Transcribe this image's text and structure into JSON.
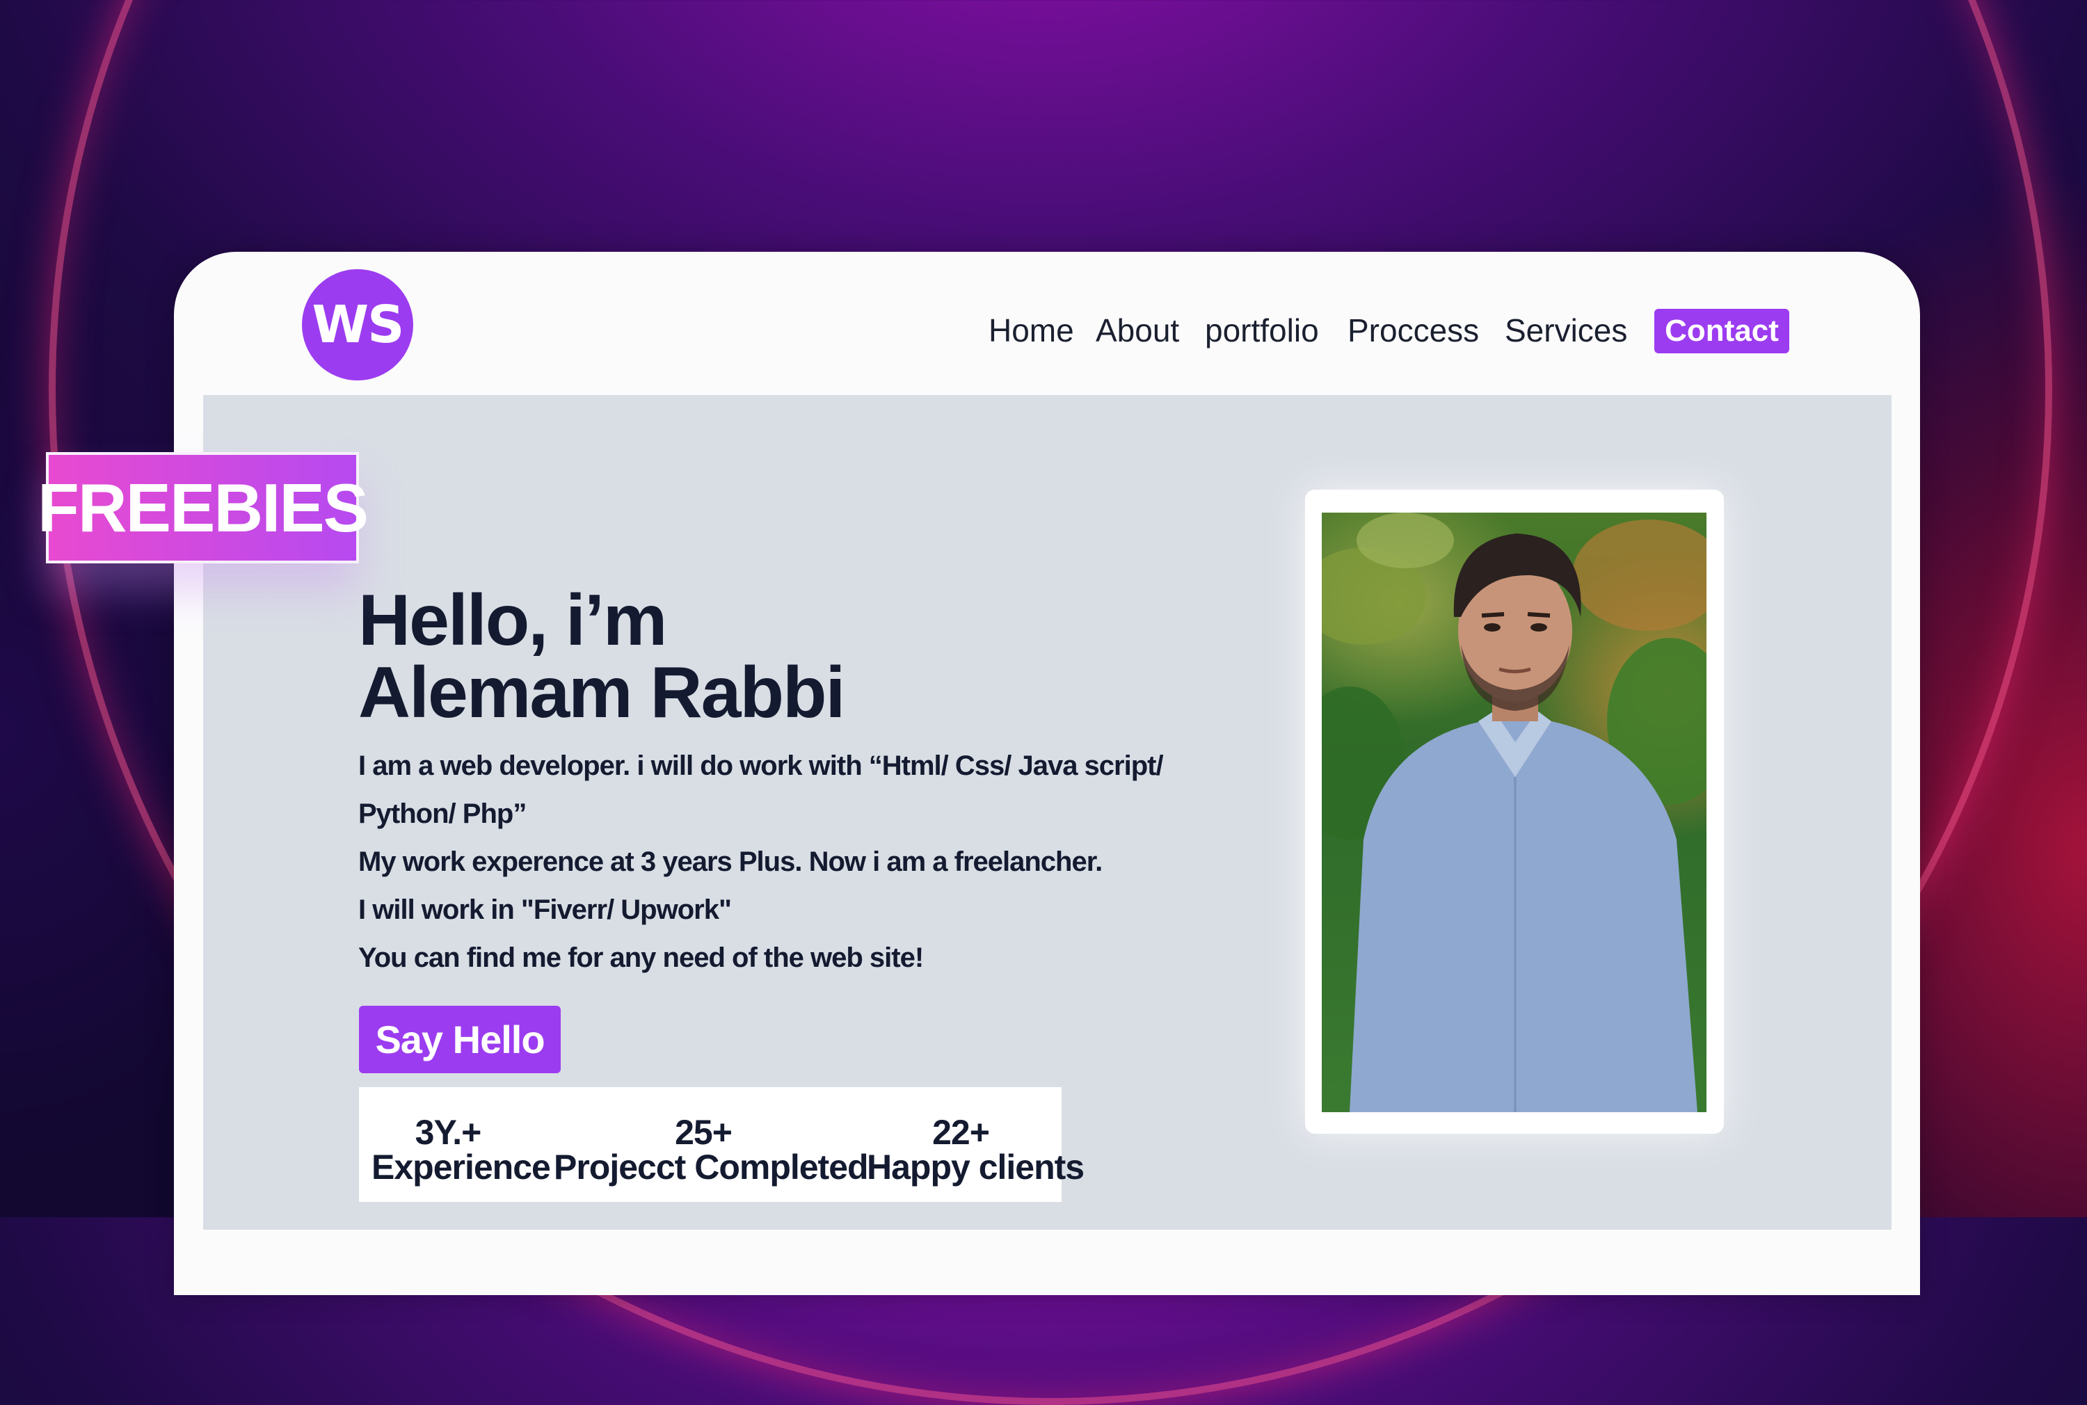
{
  "brand": {
    "logo_text": "WS",
    "accent": "#9c3cf0"
  },
  "nav": {
    "items": [
      {
        "label": "Home"
      },
      {
        "label": "About"
      },
      {
        "label": "portfolio"
      },
      {
        "label": "Proccess"
      },
      {
        "label": "Services"
      }
    ],
    "contact_label": "Contact"
  },
  "badge": {
    "label": "FREEBIES"
  },
  "hero": {
    "greeting": "Hello, i’m",
    "name": "Alemam Rabbi",
    "description_lines": [
      "I am a web developer. i will do work with “Html/ Css/ Java script/",
      "Python/ Php”",
      "My work experence at 3 years Plus. Now i am a freelancher.",
      "I will work in \"Fiverr/ Upwork\"",
      "You can find me for any need of the web site!"
    ],
    "cta_label": "Say Hello"
  },
  "stats": [
    {
      "value": "3Y.+",
      "label": "Experience"
    },
    {
      "value": "25+",
      "label": "Projecct Completed"
    },
    {
      "value": "22+",
      "label": "Happy clients"
    }
  ],
  "photo": {
    "alt": "Portrait photo"
  }
}
